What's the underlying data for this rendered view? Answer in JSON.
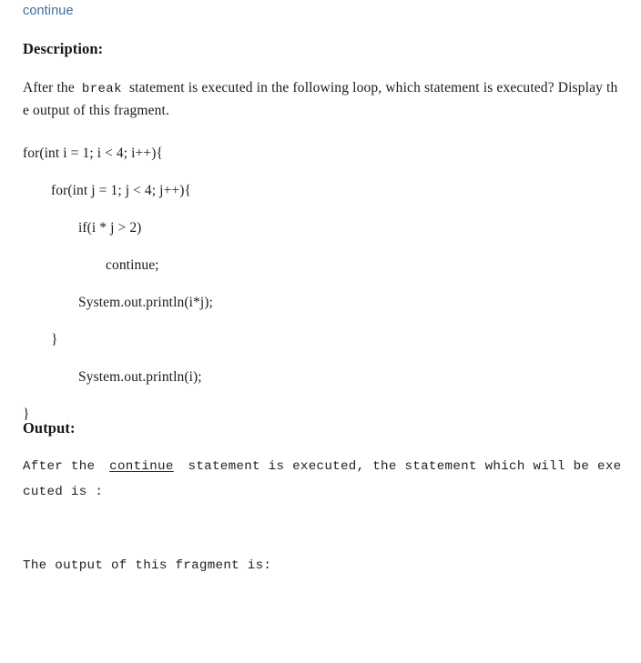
{
  "topic": {
    "link_label": "continue",
    "link_color": "#3e6f9c"
  },
  "description": {
    "heading": "Description:",
    "text_before_code": "After the",
    "inline_code": "break",
    "text_after_code": "statement is executed in the following loop, which statement is executed? Display the output of this fragment."
  },
  "code": {
    "language": "java",
    "lines": [
      {
        "indent": 0,
        "text": "for(int i = 1; i < 4; i++){"
      },
      {
        "indent": 1,
        "text": "for(int j = 1; j < 4; j++){"
      },
      {
        "indent": 2,
        "text": "if(i * j > 2)"
      },
      {
        "indent": 3,
        "text": "continue;"
      },
      {
        "indent": 2,
        "text": "System.out.println(i*j);"
      },
      {
        "indent": 1,
        "text": "}"
      },
      {
        "indent": 2,
        "text": "System.out.println(i);"
      },
      {
        "indent": 0,
        "text": "}"
      }
    ]
  },
  "output": {
    "heading": "Output:",
    "line1_before": "After the",
    "line1_keyword": "continue",
    "line1_after": "statement is executed, the statement which will be executed is :",
    "line2": "The output of this fragment is:"
  },
  "colors": {
    "page_background": "#ffffff",
    "body_text": "#1b1b1b",
    "heading_text": "#161616",
    "link": "#3e6f9c"
  }
}
